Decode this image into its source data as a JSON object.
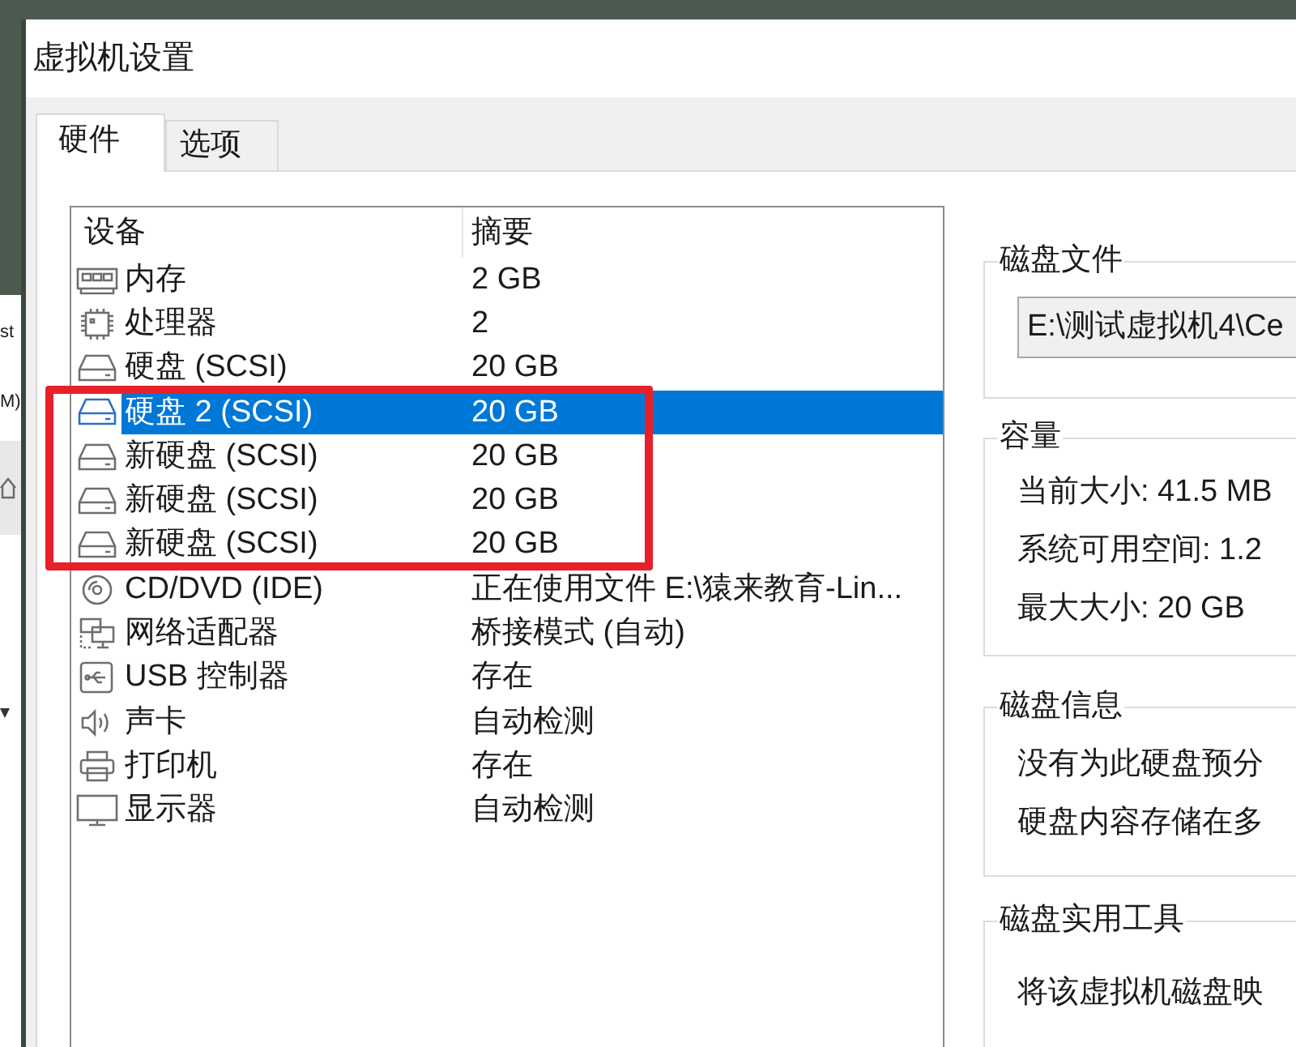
{
  "background_window": {
    "texts": [
      "st",
      "M)"
    ]
  },
  "window": {
    "title": "虚拟机设置"
  },
  "tabs": [
    {
      "label": "硬件",
      "selected": true
    },
    {
      "label": "选项",
      "selected": false
    }
  ],
  "device_list": {
    "columns": [
      "设备",
      "摘要"
    ],
    "rows": [
      {
        "kind": "memory",
        "device": "内存",
        "summary": "2 GB",
        "selected": false
      },
      {
        "kind": "processor",
        "device": "处理器",
        "summary": "2",
        "selected": false
      },
      {
        "kind": "disk",
        "device": "硬盘 (SCSI)",
        "summary": "20 GB",
        "selected": false
      },
      {
        "kind": "disk",
        "device": "硬盘 2 (SCSI)",
        "summary": "20 GB",
        "selected": true
      },
      {
        "kind": "disk",
        "device": "新硬盘 (SCSI)",
        "summary": "20 GB",
        "selected": false
      },
      {
        "kind": "disk",
        "device": "新硬盘 (SCSI)",
        "summary": "20 GB",
        "selected": false
      },
      {
        "kind": "disk",
        "device": "新硬盘 (SCSI)",
        "summary": "20 GB",
        "selected": false
      },
      {
        "kind": "cd",
        "device": "CD/DVD (IDE)",
        "summary": "正在使用文件 E:\\猿来教育-Lin...",
        "selected": false
      },
      {
        "kind": "network",
        "device": "网络适配器",
        "summary": "桥接模式 (自动)",
        "selected": false
      },
      {
        "kind": "usb",
        "device": "USB 控制器",
        "summary": "存在",
        "selected": false
      },
      {
        "kind": "sound",
        "device": "声卡",
        "summary": "自动检测",
        "selected": false
      },
      {
        "kind": "printer",
        "device": "打印机",
        "summary": "存在",
        "selected": false
      },
      {
        "kind": "display",
        "device": "显示器",
        "summary": "自动检测",
        "selected": false
      }
    ]
  },
  "disk_file": {
    "title": "磁盘文件",
    "value": "E:\\测试虚拟机4\\Ce"
  },
  "capacity": {
    "title": "容量",
    "lines": [
      "当前大小: 41.5 MB",
      "系统可用空间: 1.2",
      "最大大小: 20 GB"
    ]
  },
  "disk_info": {
    "title": "磁盘信息",
    "lines": [
      "没有为此硬盘预分",
      "硬盘内容存储在多"
    ]
  },
  "disk_utilities": {
    "title": "磁盘实用工具",
    "lines": [
      "将该虚拟机磁盘映"
    ]
  }
}
